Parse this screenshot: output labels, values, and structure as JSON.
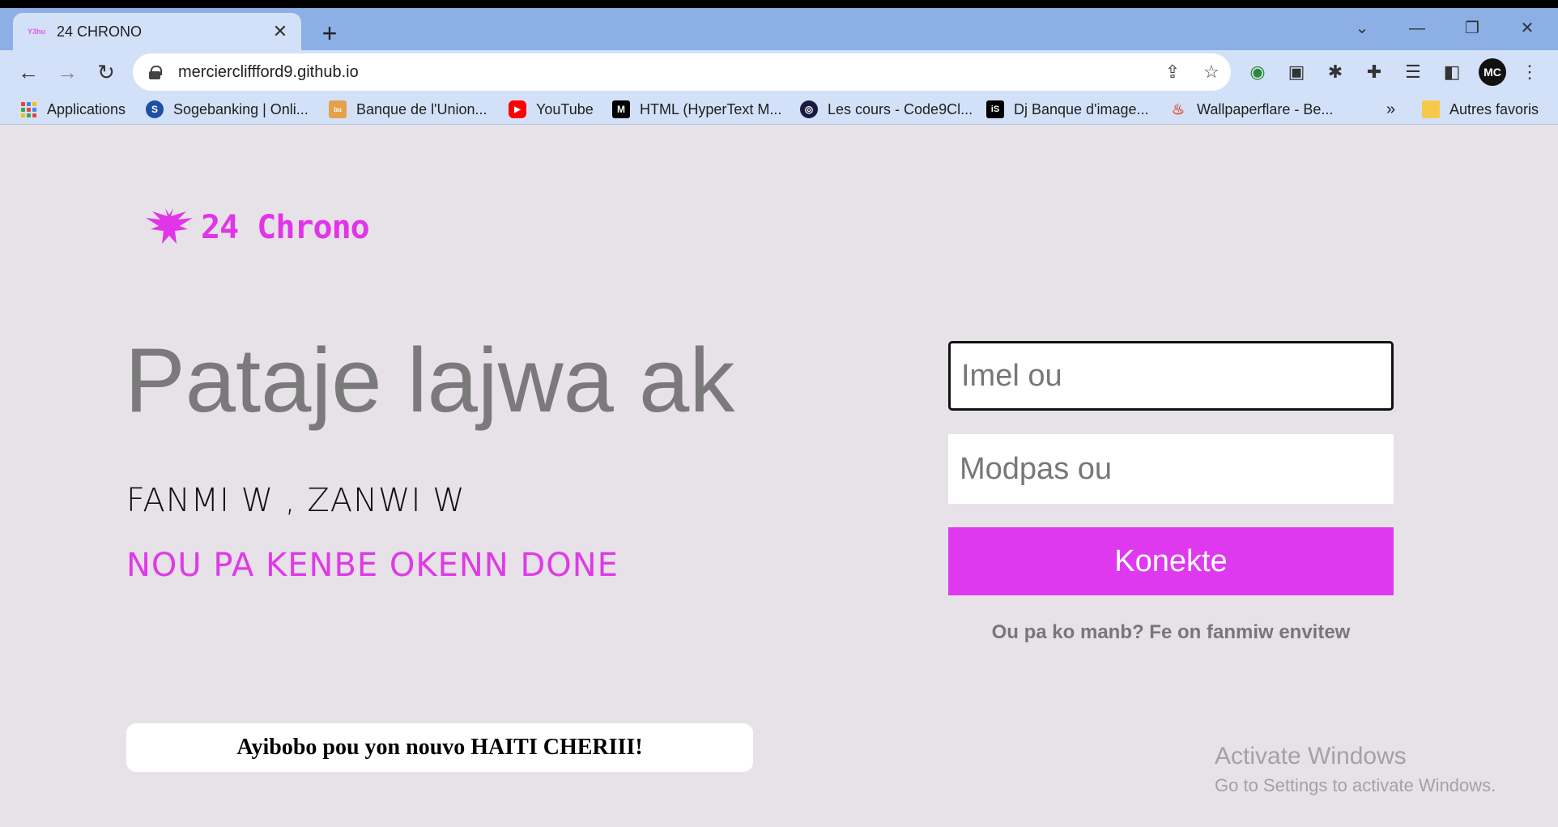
{
  "browser": {
    "tab_title": "24 CHRONO",
    "tab_favicon_text": "Y3hu",
    "url": "merciercliffford9.github.io",
    "avatar_initials": "MC"
  },
  "bookmarks": [
    {
      "label": "Applications",
      "icon": "apps-grid-icon"
    },
    {
      "label": "Sogebanking | Onli...",
      "icon": "sogebank-icon",
      "color": "#1d4fa3"
    },
    {
      "label": "Banque de l'Union...",
      "icon": "bank-icon",
      "color": "#e3a24a"
    },
    {
      "label": "YouTube",
      "icon": "youtube-icon",
      "color": "#ff0000"
    },
    {
      "label": "HTML (HyperText M...",
      "icon": "mdn-icon",
      "color": "#000000"
    },
    {
      "label": "Les cours - Code9Cl...",
      "icon": "code9-icon",
      "color": "#1a1a40"
    },
    {
      "label": "Dj Banque d'image...",
      "icon": "istock-icon",
      "color": "#000000"
    },
    {
      "label": "Wallpaperflare - Be...",
      "icon": "wallpaperflare-icon",
      "color": "#e0533a"
    }
  ],
  "bookmarks_overflow": "»",
  "other_bookmarks": "Autres favoris",
  "page": {
    "logo_text": "24 Chrono",
    "hero": "Pataje lajwa ak",
    "subtitle1": "FANMI W , ZANWI W",
    "subtitle2": "NOU PA KENBE OKENN DONE",
    "banner": "Ayibobo pou yon nouvo HAITI CHERIII!",
    "email_placeholder": "Imel ou",
    "password_placeholder": "Modpas ou",
    "login_button": "Konekte",
    "signup_text": "Ou pa ko manb? Fe on fanmiw envitew"
  },
  "watermark": {
    "line1": "Activate Windows",
    "line2": "Go to Settings to activate Windows."
  },
  "colors": {
    "accent": "#df39ef",
    "page_bg": "#e7e1e8",
    "tabstrip_bg": "#8cafe6",
    "toolbar_bg": "#d3e1f8"
  }
}
